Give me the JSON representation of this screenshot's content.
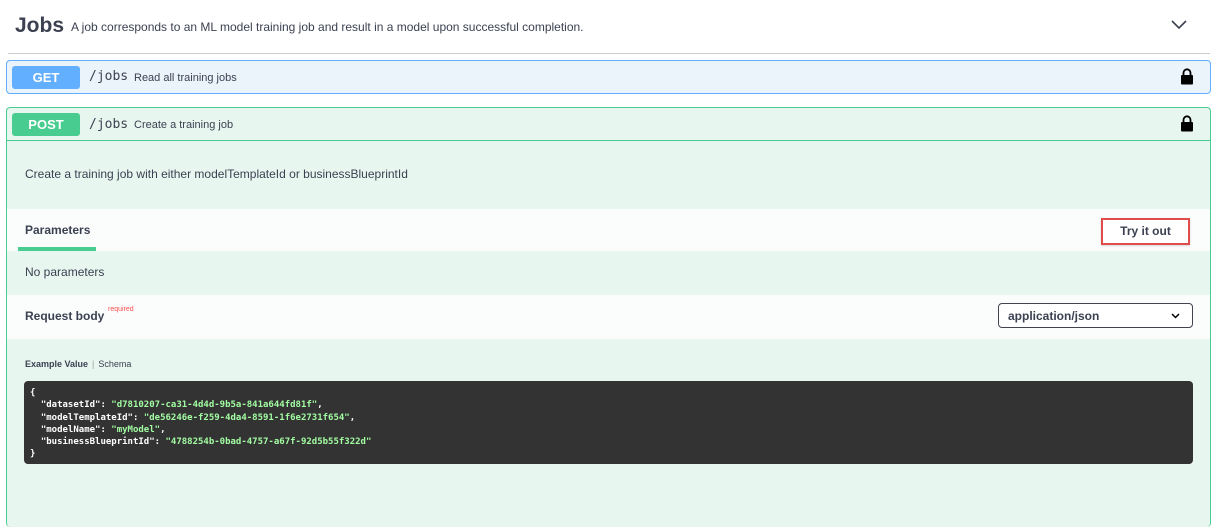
{
  "tag": {
    "name": "Jobs",
    "description": "A job corresponds to an ML model training job and result in a model upon successful completion."
  },
  "get_op": {
    "method": "GET",
    "path": "/jobs",
    "summary": "Read all training jobs"
  },
  "post_op": {
    "method": "POST",
    "path": "/jobs",
    "summary": "Create a training job",
    "description": "Create a training job with either modelTemplateId or businessBlueprintId",
    "parameters_tab": "Parameters",
    "try_it_out": "Try it out",
    "no_parameters": "No parameters",
    "request_body_label": "Request body",
    "required_label": "required",
    "content_type": "application/json",
    "example_tab": "Example Value",
    "schema_tab": "Schema",
    "example": {
      "open": "{",
      "close": "}",
      "lines": [
        {
          "key": "\"datasetId\"",
          "value": "\"d7810207-ca31-4d4d-9b5a-841a644fd81f\"",
          "comma": ","
        },
        {
          "key": "\"modelTemplateId\"",
          "value": "\"de56246e-f259-4da4-8591-1f6e2731f654\"",
          "comma": ","
        },
        {
          "key": "\"modelName\"",
          "value": "\"myModel\"",
          "comma": ","
        },
        {
          "key": "\"businessBlueprintId\"",
          "value": "\"4788254b-0bad-4757-a67f-92d5b55f322d\"",
          "comma": ""
        }
      ]
    }
  },
  "colors": {
    "get": "#61affe",
    "post": "#49cc90",
    "highlight": "#e04b4b"
  }
}
